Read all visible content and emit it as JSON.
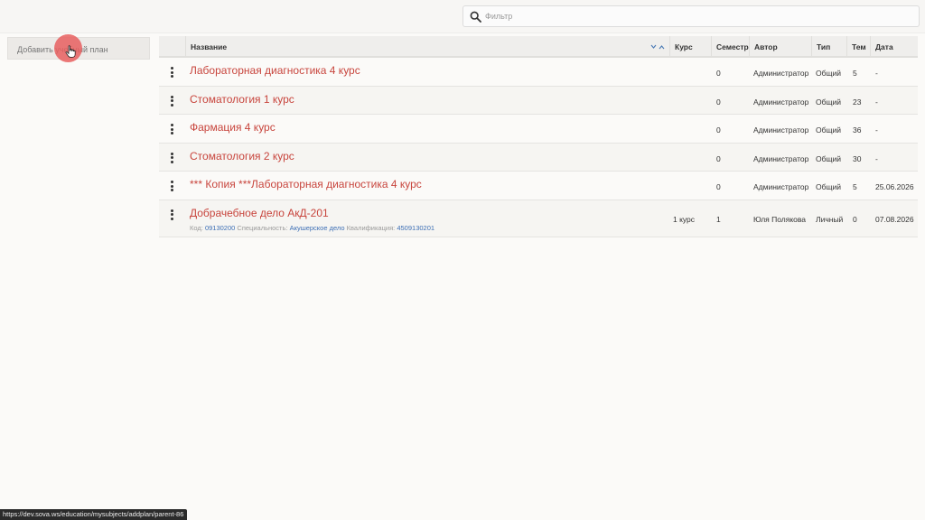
{
  "search": {
    "placeholder": "Фильтр"
  },
  "sidebar": {
    "add_plan_label": "Добавить учебный план"
  },
  "table": {
    "headers": {
      "name": "Название",
      "course": "Курс",
      "semester": "Семестр",
      "author": "Автор",
      "type": "Тип",
      "topics": "Тем",
      "date": "Дата"
    },
    "rows": [
      {
        "title": "Лабораторная диагностика 4 курс",
        "course": "",
        "semester": "0",
        "author": "Администратор",
        "type": "Общий",
        "topics": "5",
        "date": "-"
      },
      {
        "title": "Стоматология 1 курс",
        "course": "",
        "semester": "0",
        "author": "Администратор",
        "type": "Общий",
        "topics": "23",
        "date": "-"
      },
      {
        "title": "Фармация 4 курс",
        "course": "",
        "semester": "0",
        "author": "Администратор",
        "type": "Общий",
        "topics": "36",
        "date": "-"
      },
      {
        "title": "Стоматология 2 курс",
        "course": "",
        "semester": "0",
        "author": "Администратор",
        "type": "Общий",
        "topics": "30",
        "date": "-"
      },
      {
        "title": "*** Копия ***Лабораторная диагностика 4 курс",
        "course": "",
        "semester": "0",
        "author": "Администратор",
        "type": "Общий",
        "topics": "5",
        "date": "25.06.2026"
      },
      {
        "title": "Добрачебное дело АкД-201",
        "course": "1 курс",
        "semester": "1",
        "author": "Юля Полякова",
        "type": "Личный",
        "topics": "0",
        "date": "07.08.2026",
        "meta": {
          "code_label": "Код:",
          "code": "09130200",
          "spec_label": "Специальность:",
          "spec": "Акушерское дело",
          "qual_label": "Квалификация:",
          "qual": "4509130201"
        }
      }
    ]
  },
  "status_bar": {
    "url": "https://dev.sova.ws/education/mysubjects/addplan/parent-86"
  },
  "icons": {
    "search": "search-icon",
    "menu": "vertical-dots-icon",
    "sort": "sort-chevrons-icon",
    "cursor": "hand-pointer-icon"
  },
  "colors": {
    "link": "#c8453d",
    "meta_link": "#3d6fb5",
    "cursor_highlight": "#e85f5f"
  }
}
